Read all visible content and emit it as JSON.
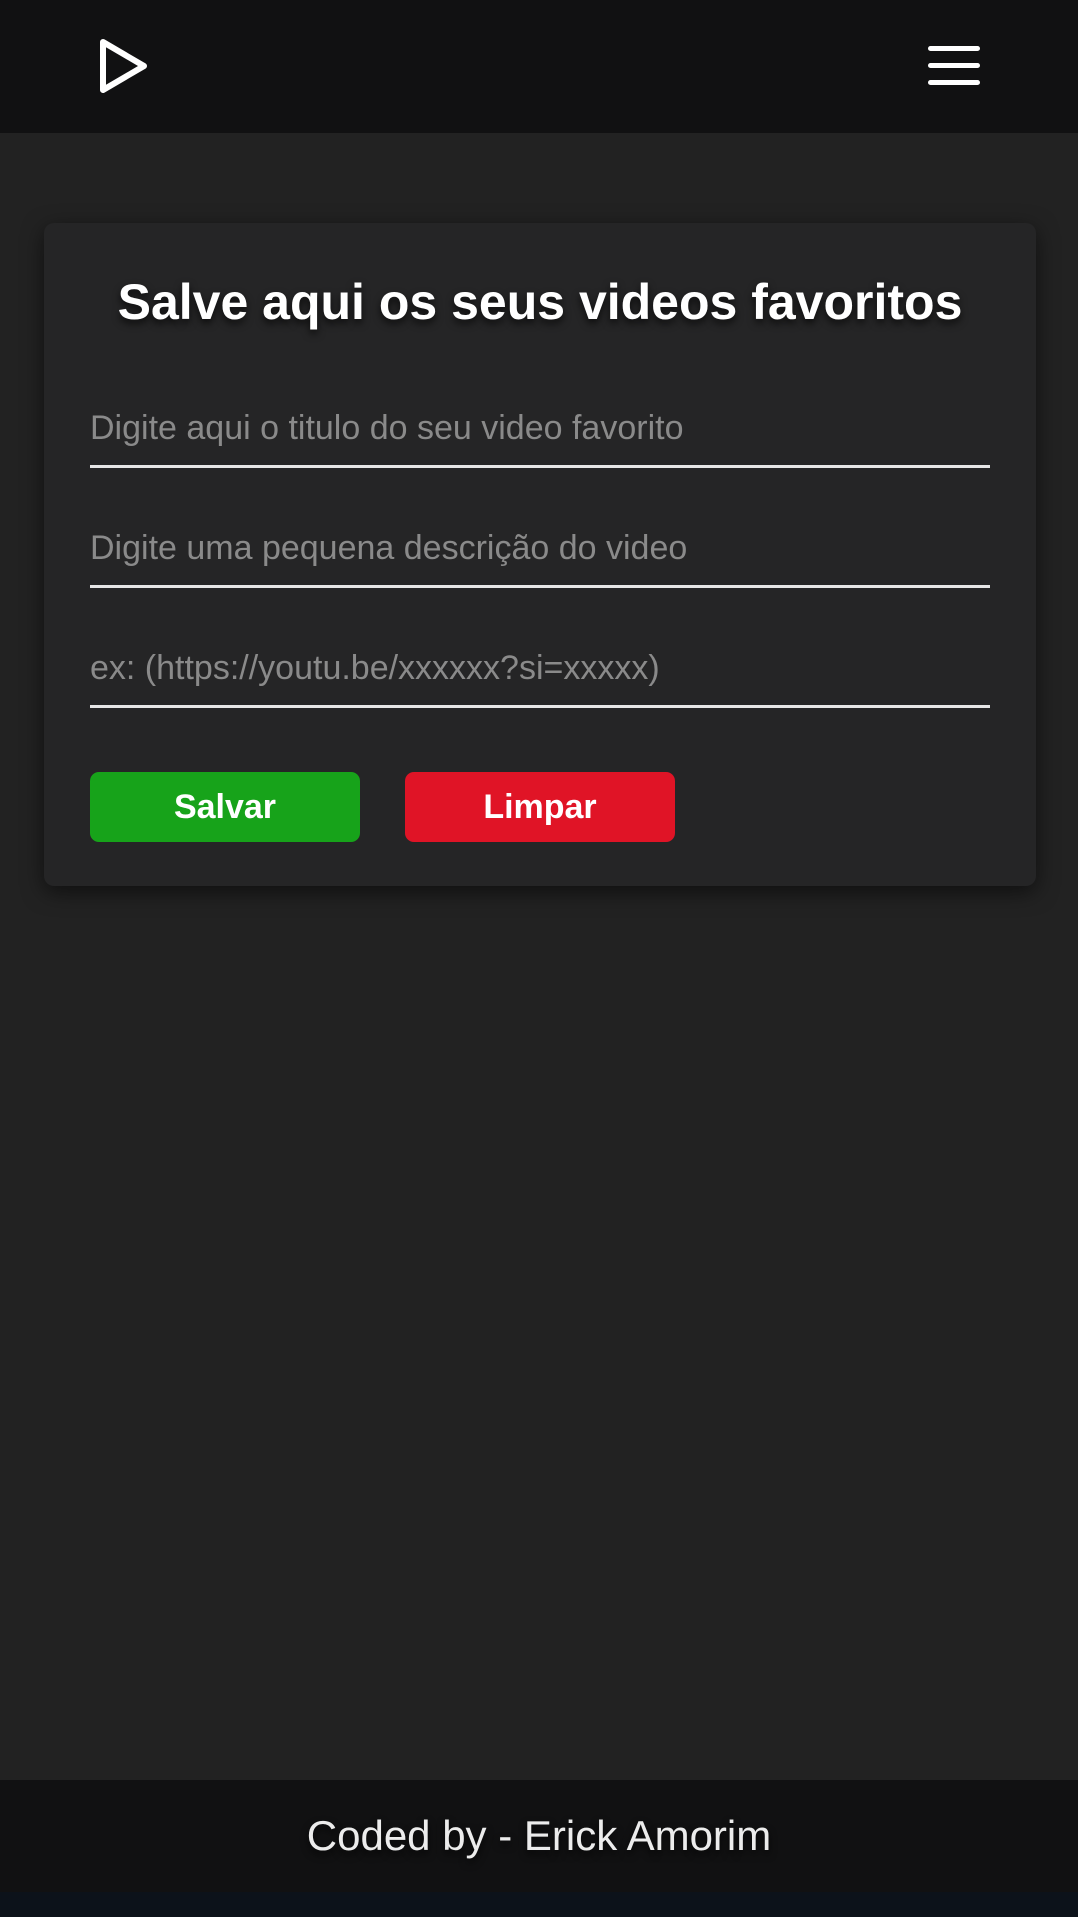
{
  "header": {
    "logo_icon": "play-icon",
    "menu_icon": "hamburger-menu-icon"
  },
  "form": {
    "title": "Salve aqui os seus videos favoritos",
    "title_input_placeholder": "Digite aqui o titulo do seu video favorito",
    "description_input_placeholder": "Digite uma pequena descrição do video",
    "url_input_placeholder": "ex: (https://youtu.be/xxxxxx?si=xxxxx)",
    "save_label": "Salvar",
    "clear_label": "Limpar"
  },
  "footer": {
    "credit": "Coded by - Erick Amorim"
  },
  "colors": {
    "background": "#222222",
    "bar": "#111112",
    "card": "#252526",
    "save": "#17a31a",
    "clear": "#e01426"
  }
}
